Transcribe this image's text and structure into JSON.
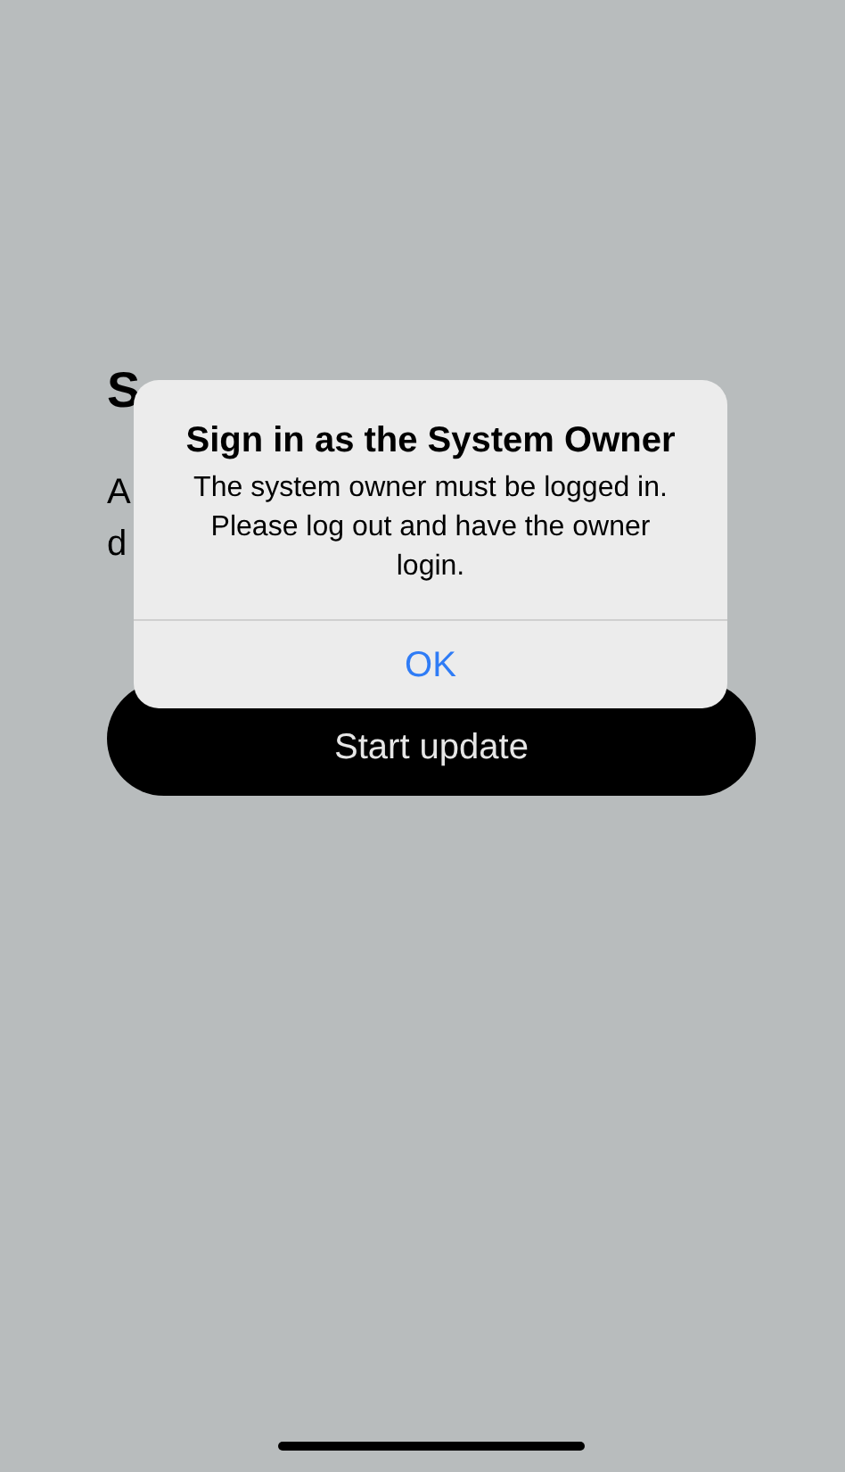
{
  "screen": {
    "heading": "S",
    "body_lines": [
      "A",
      "d"
    ],
    "button": "Start update"
  },
  "alert": {
    "title": "Sign in as the System Owner",
    "message": "The system owner must be logged in. Please log out and have the owner login.",
    "buttons": [
      "OK"
    ]
  }
}
